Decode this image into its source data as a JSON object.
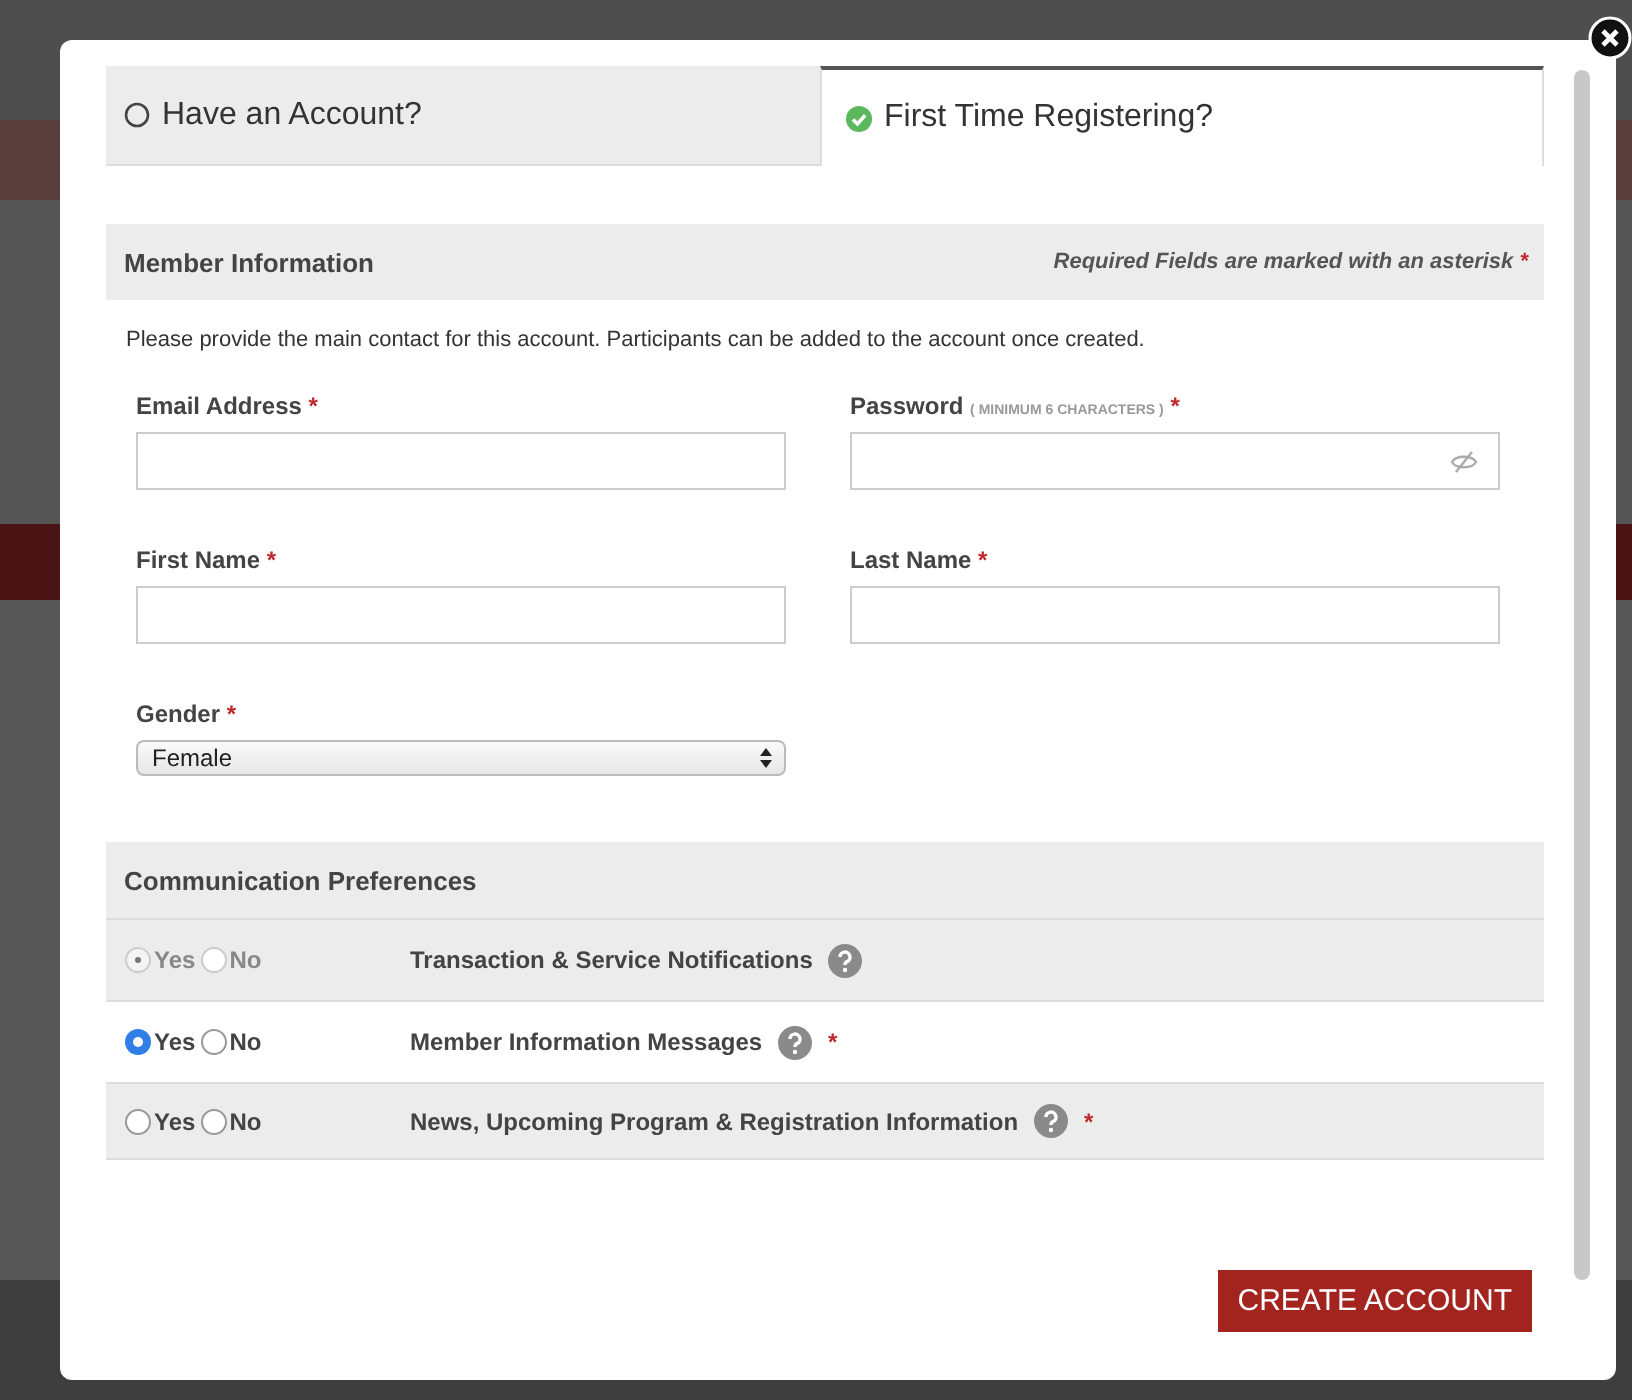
{
  "tabs": [
    {
      "label": "Have an Account?",
      "selected": false
    },
    {
      "label": "First Time Registering?",
      "selected": true
    }
  ],
  "required_mark": "*",
  "member_information": {
    "title": "Member Information",
    "required_note": "Required Fields are marked with an asterisk",
    "intro": "Please provide the main contact for this account. Participants can be added to the account once created.",
    "fields": [
      {
        "kind": "text",
        "label": "Email Address",
        "required": true
      },
      {
        "kind": "password",
        "label": "Password",
        "hint": "( MINIMUM 6 CHARACTERS )",
        "required": true
      },
      {
        "kind": "text",
        "label": "First Name",
        "required": true
      },
      {
        "kind": "text",
        "label": "Last Name",
        "required": true
      },
      {
        "kind": "select",
        "label": "Gender",
        "value": "Female",
        "required": true
      }
    ]
  },
  "communication_preferences": {
    "title": "Communication Preferences",
    "rows": [
      {
        "label": "Transaction & Service Notifications",
        "required": false,
        "disabled": true,
        "options": [
          {
            "label": "Yes",
            "selected": true
          },
          {
            "label": "No",
            "selected": false
          }
        ]
      },
      {
        "label": "Member Information Messages",
        "required": true,
        "disabled": false,
        "options": [
          {
            "label": "Yes",
            "selected": true
          },
          {
            "label": "No",
            "selected": false
          }
        ]
      },
      {
        "label": "News, Upcoming Program & Registration Information",
        "required": true,
        "disabled": false,
        "options": [
          {
            "label": "Yes",
            "selected": false
          },
          {
            "label": "No",
            "selected": false
          }
        ]
      }
    ]
  },
  "submit": {
    "label": "CREATE ACCOUNT"
  }
}
